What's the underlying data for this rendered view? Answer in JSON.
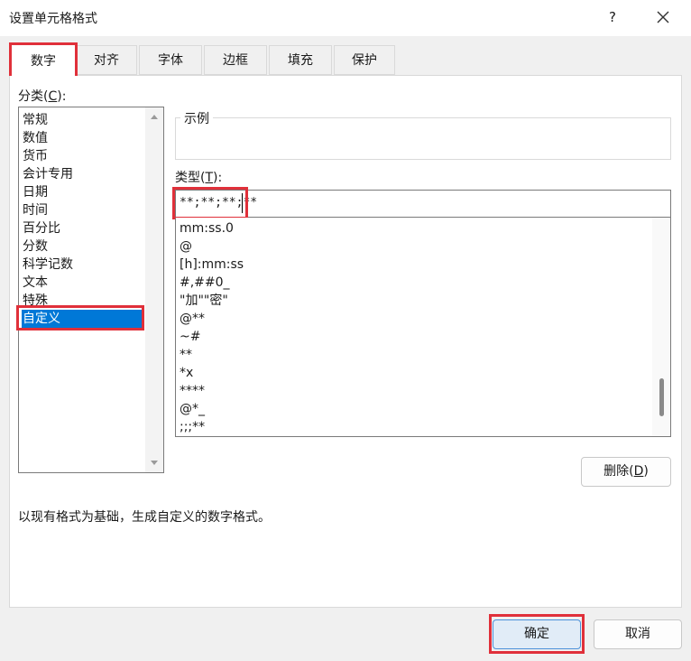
{
  "window": {
    "title": "设置单元格格式",
    "help": "?"
  },
  "tabs": [
    {
      "label": "数字"
    },
    {
      "label": "对齐"
    },
    {
      "label": "字体"
    },
    {
      "label": "边框"
    },
    {
      "label": "填充"
    },
    {
      "label": "保护"
    }
  ],
  "category": {
    "label_prefix": "分类(",
    "label_key": "C",
    "label_suffix": "):",
    "items": [
      "常规",
      "数值",
      "货币",
      "会计专用",
      "日期",
      "时间",
      "百分比",
      "分数",
      "科学记数",
      "文本",
      "特殊",
      "自定义"
    ],
    "selected": "自定义"
  },
  "sample": {
    "legend": "示例"
  },
  "type": {
    "label_prefix": "类型(",
    "label_key": "T",
    "label_suffix": "):",
    "value": "**;**;**;**"
  },
  "formats": [
    "mm:ss.0",
    "@",
    "[h]:mm:ss",
    "#,##0_",
    "\"加\"\"密\"",
    "@**",
    "~#",
    "**",
    "*x",
    "****",
    "@*_",
    ";;;**"
  ],
  "buttons": {
    "delete_prefix": "删除(",
    "delete_key": "D",
    "delete_suffix": ")",
    "ok": "确定",
    "cancel": "取消"
  },
  "description": "以现有格式为基础，生成自定义的数字格式。",
  "colors": {
    "accent": "#0078d7",
    "highlight": "#e0303a"
  }
}
